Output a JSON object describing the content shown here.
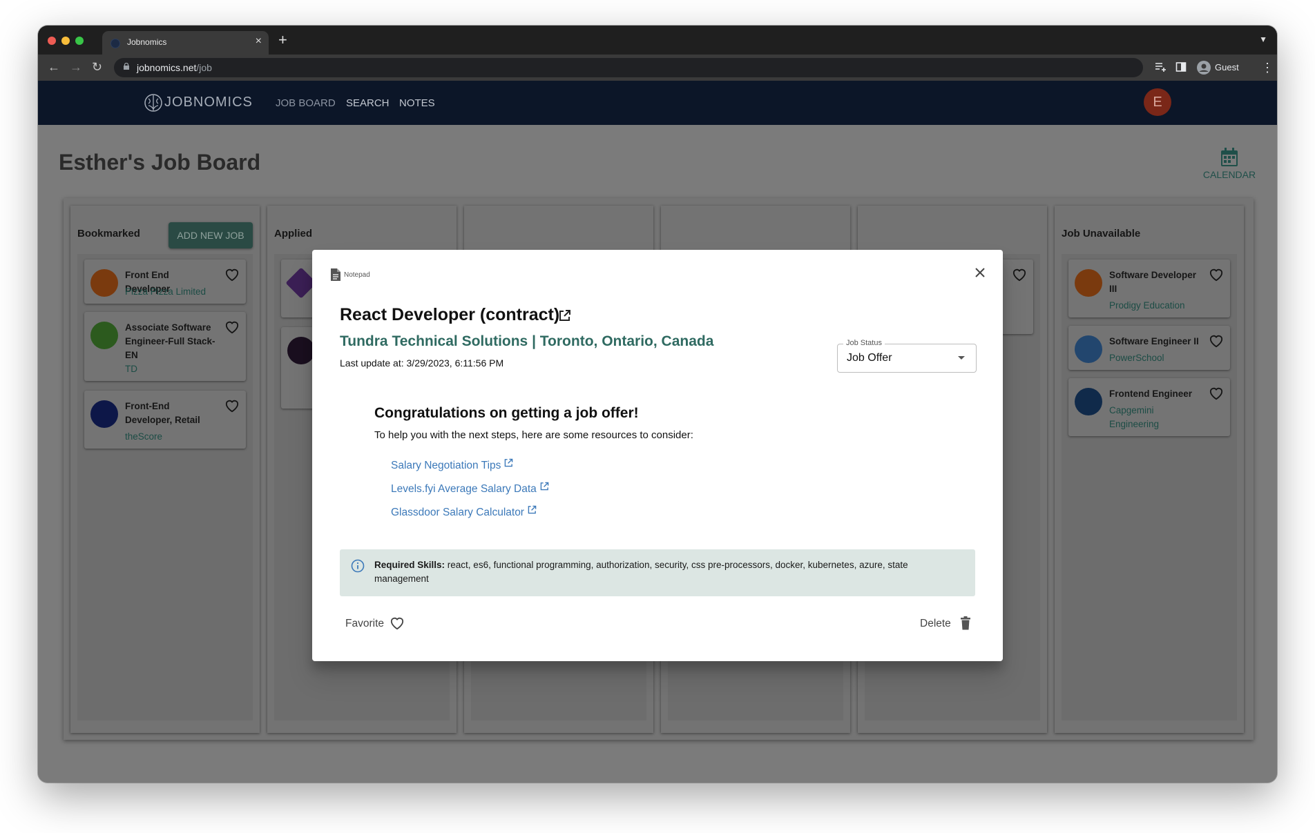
{
  "browser": {
    "tab_title": "Jobnomics",
    "url_host": "jobnomics.net",
    "url_path": "/job",
    "profile_label": "Guest"
  },
  "app": {
    "logo_text": "JOBNOMICS",
    "nav": [
      "JOB BOARD",
      "SEARCH",
      "NOTES"
    ],
    "avatar_letter": "E",
    "board_title": "Esther's Job Board",
    "calendar_label": "CALENDAR"
  },
  "columns": {
    "bookmarked": {
      "title": "Bookmarked",
      "add_button": "ADD NEW JOB",
      "cards": [
        {
          "title": "Front End Developer",
          "company": "Pizza Pizza Limited",
          "logo_color": "#7a3a0e"
        },
        {
          "title": "Associate Software Engineer-Full Stack-EN",
          "company": "TD",
          "logo_color": "#2c5a1e"
        },
        {
          "title": "Front-End Developer, Retail",
          "company": "theScore",
          "logo_color": "#0d1748"
        }
      ]
    },
    "applied": {
      "title": "Applied"
    },
    "unavailable": {
      "title": "Job Unavailable",
      "cards": [
        {
          "title": "Software Developer III",
          "company": "Prodigy Education",
          "logo_color": "#7a3a0e"
        },
        {
          "title": "Software Engineer II",
          "company": "PowerSchool",
          "logo_color": "#22466e"
        },
        {
          "title": "Frontend Engineer",
          "company": "Capgemini Engineering",
          "logo_color": "#102a4a"
        }
      ]
    }
  },
  "modal": {
    "notepad_label": "Notepad",
    "job_title": "React Developer (contract)",
    "company_location": "Tundra Technical Solutions | Toronto, Ontario, Canada",
    "last_update": "Last update at: 3/29/2023, 6:11:56 PM",
    "status_label": "Job Status",
    "status_value": "Job Offer",
    "congrats_heading": "Congratulations on getting a job offer!",
    "help_text": "To help you with the next steps, here are some resources to consider:",
    "resources": [
      "Salary Negotiation Tips",
      "Levels.fyi Average Salary Data",
      "Glassdoor Salary Calculator"
    ],
    "skills_label": "Required Skills:",
    "skills_text": "react, es6, functional programming, authorization, security, css pre-processors, docker, kubernetes, azure, state management",
    "favorite_label": "Favorite",
    "delete_label": "Delete"
  },
  "colors": {
    "accent_green": "#2f6a61",
    "link_blue": "#3c79b9",
    "appbar": "#0c1628"
  }
}
